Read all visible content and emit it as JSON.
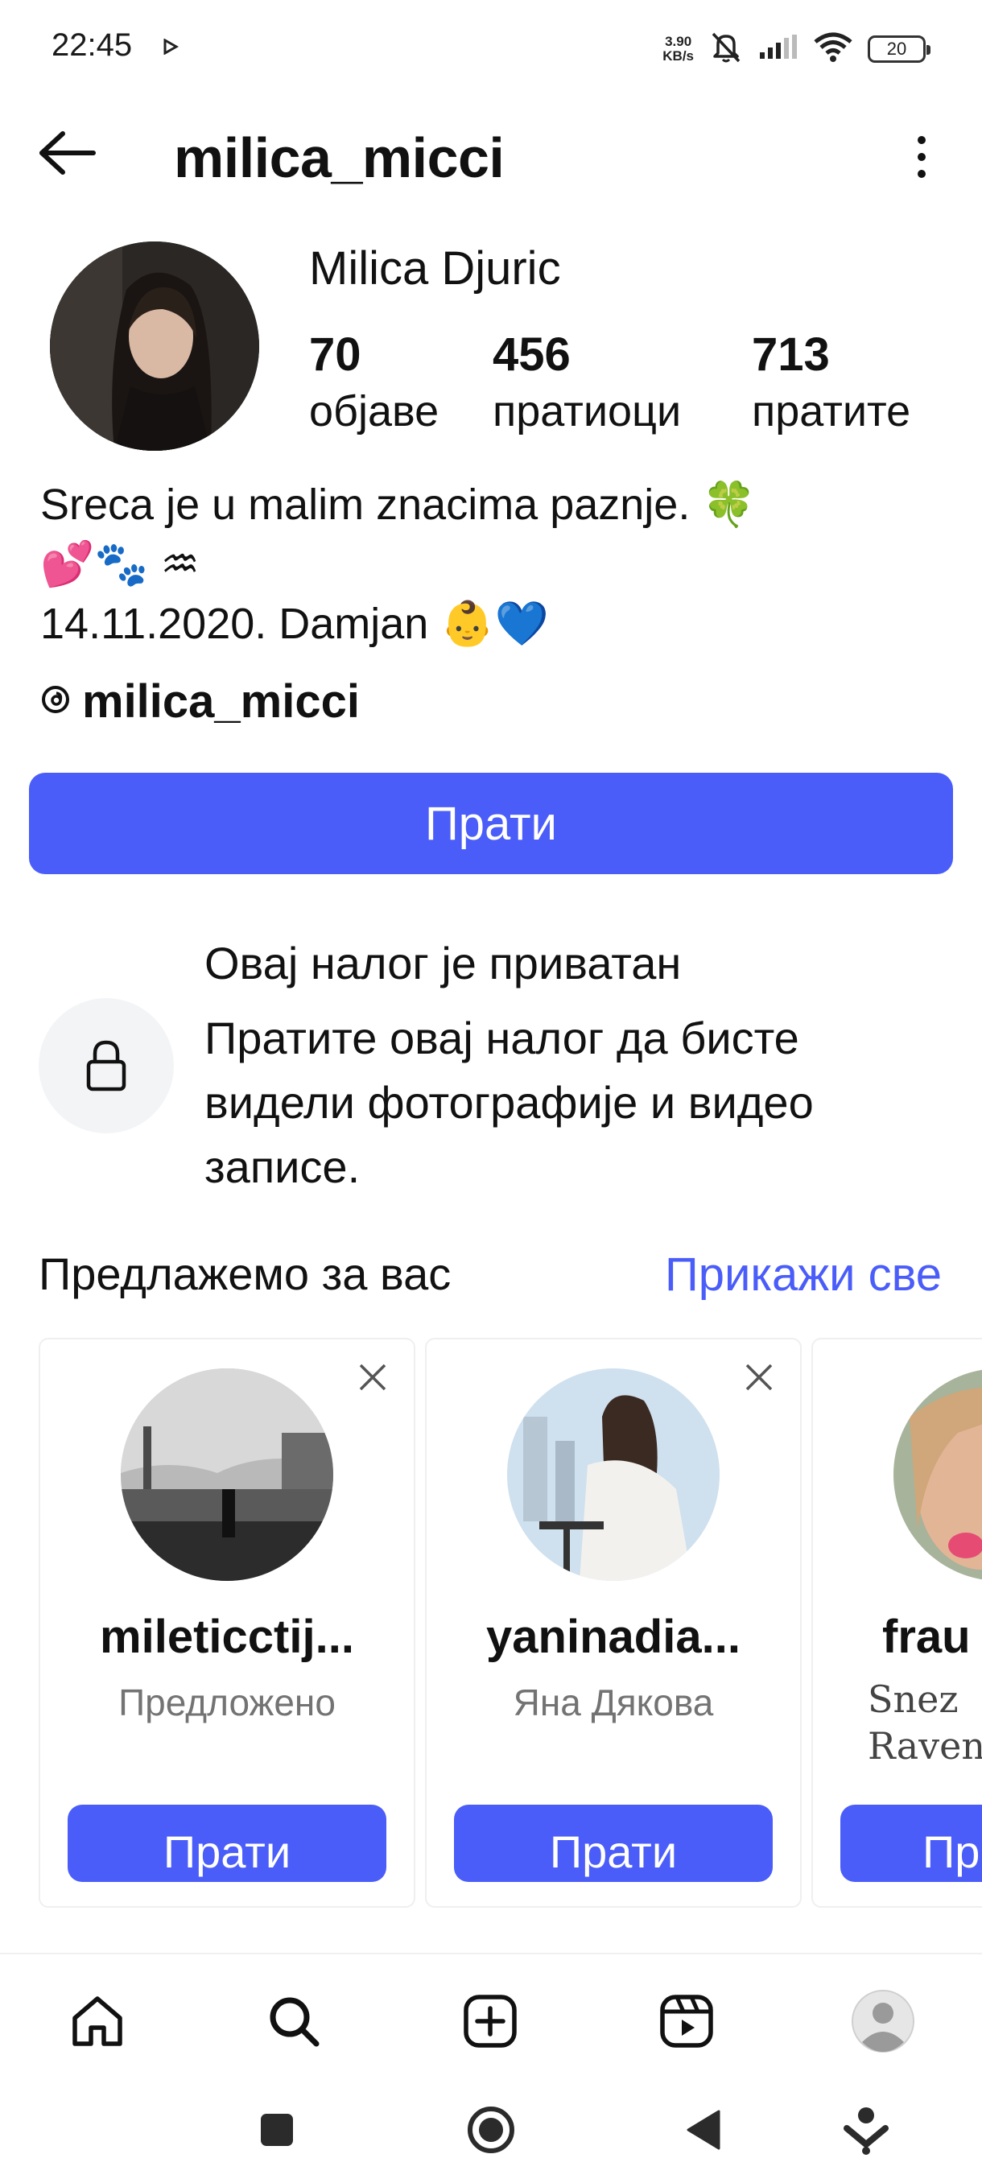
{
  "status_bar": {
    "time": "22:45",
    "network_speed_value": "3.90",
    "network_speed_unit": "KB/s",
    "battery": "20"
  },
  "header": {
    "username": "milica_micci"
  },
  "profile": {
    "display_name": "Milica Djuric",
    "stats": [
      {
        "value": "70",
        "label": "објаве"
      },
      {
        "value": "456",
        "label": "пратиоци"
      },
      {
        "value": "713",
        "label": "пратите"
      }
    ],
    "bio_line1": "Sreca je u malim znacima paznje. 🍀",
    "bio_line2": "💕🐾 ♒",
    "bio_line3": "14.11.2020. Damjan 👶💙",
    "threads_handle": "milica_micci",
    "follow_label": "Прати"
  },
  "private_notice": {
    "title": "Овај налог је приватан",
    "description": "Пратите овај налог да бисте видели фотографије и видео записе."
  },
  "suggestions": {
    "title": "Предлажемо за вас",
    "see_all": "Прикажи све",
    "cards": [
      {
        "username": "mileticctij...",
        "subtitle": "Предложено",
        "follow_label": "Прати"
      },
      {
        "username": "yaninadia...",
        "subtitle": "Яна Дякова",
        "follow_label": "Прати"
      },
      {
        "username": "frau",
        "subtitle": "Snez",
        "subtitle2": "Raven",
        "follow_label": "Пр"
      }
    ]
  },
  "colors": {
    "accent": "#4a5df9",
    "muted_text": "#737373"
  }
}
